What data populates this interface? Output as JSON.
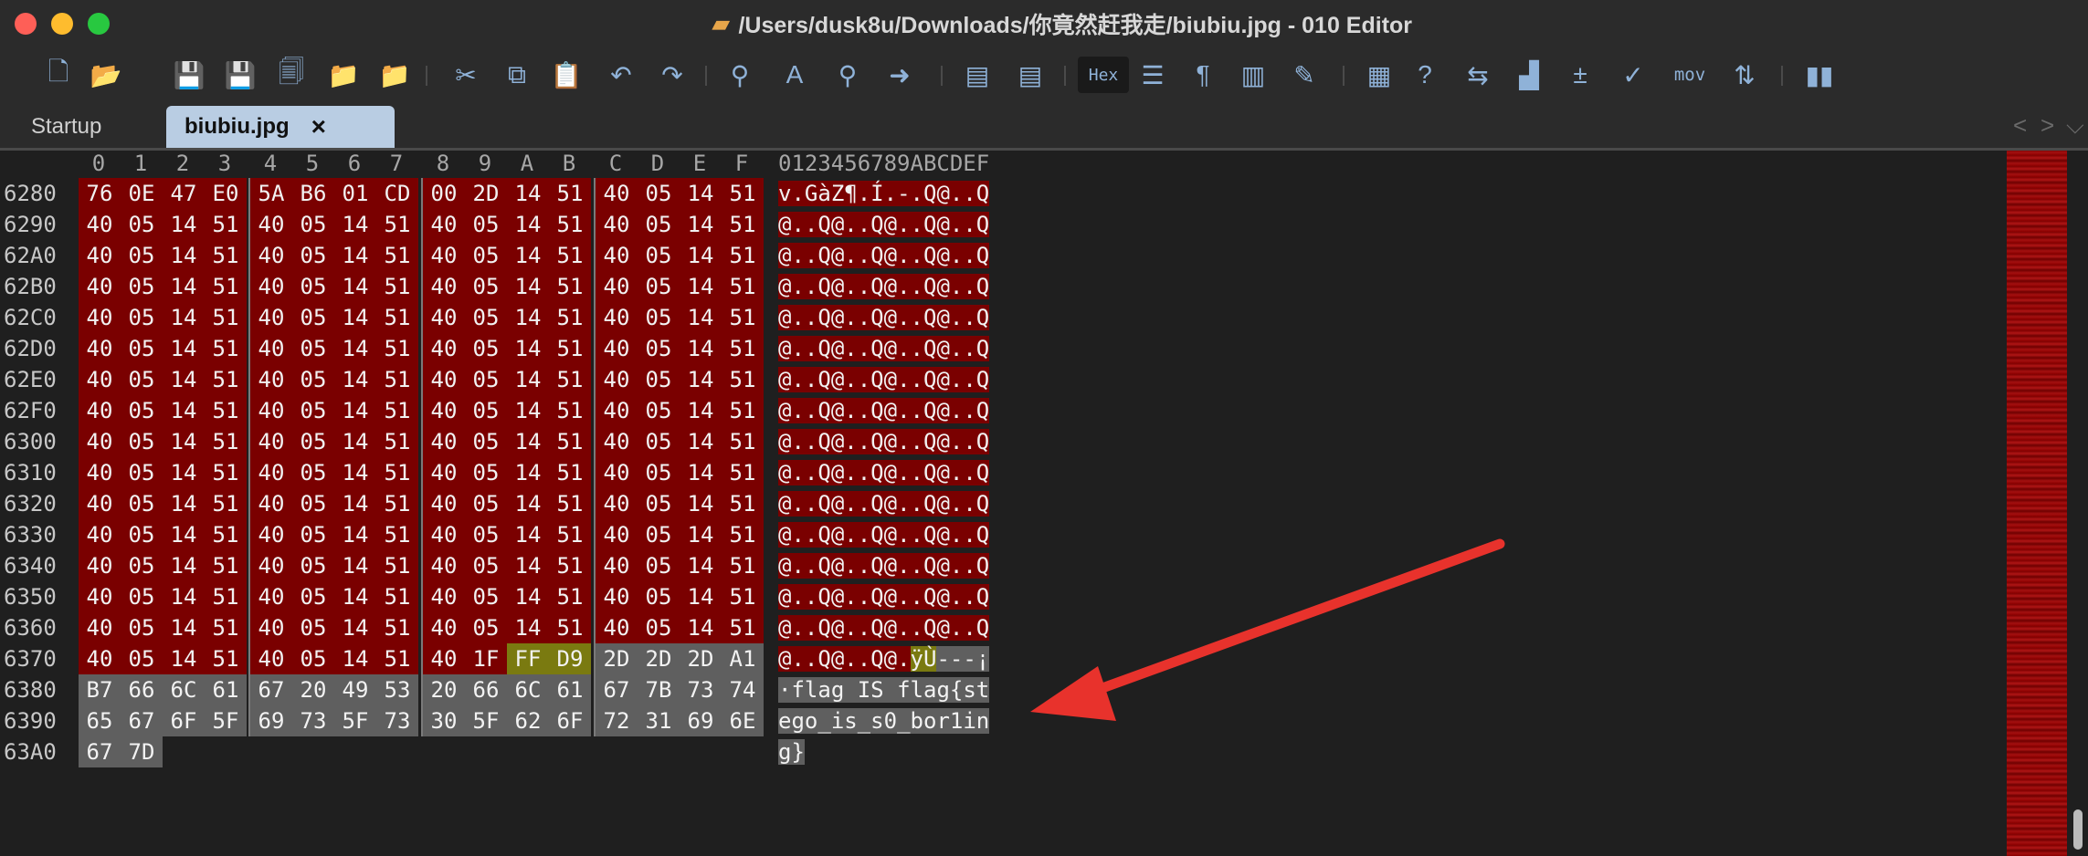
{
  "window": {
    "title": "/Users/dusk8u/Downloads/你竟然赶我走/biubiu.jpg - 010 Editor",
    "title_icon": "document-icon"
  },
  "toolbar": {
    "buttons": [
      {
        "name": "new-file-icon",
        "glyph": "🗋"
      },
      {
        "name": "open-file-icon",
        "glyph": "📂"
      },
      {
        "name": "save-icon",
        "glyph": "💾"
      },
      {
        "name": "save-as-icon",
        "glyph": "💾"
      },
      {
        "name": "save-all-icon",
        "glyph": "🗐"
      },
      {
        "name": "open-folder-icon",
        "glyph": "📁"
      },
      {
        "name": "open-workspace-icon",
        "glyph": "📁"
      },
      {
        "name": "cut-icon",
        "glyph": "✂"
      },
      {
        "name": "copy-icon",
        "glyph": "⧉"
      },
      {
        "name": "paste-icon",
        "glyph": "📋"
      },
      {
        "name": "undo-icon",
        "glyph": "↶"
      },
      {
        "name": "redo-icon",
        "glyph": "↷"
      },
      {
        "name": "find-icon",
        "glyph": "⚲"
      },
      {
        "name": "replace-icon",
        "glyph": "A"
      },
      {
        "name": "find-in-files-icon",
        "glyph": "⚲"
      },
      {
        "name": "goto-icon",
        "glyph": "➜"
      },
      {
        "name": "run-script-icon",
        "glyph": "▤"
      },
      {
        "name": "run-template-icon",
        "glyph": "▤"
      },
      {
        "name": "hex-mode-button",
        "glyph": "Hex"
      },
      {
        "name": "columns-icon",
        "glyph": "☰"
      },
      {
        "name": "show-whitespace-icon",
        "glyph": "¶"
      },
      {
        "name": "line-width-icon",
        "glyph": "▥"
      },
      {
        "name": "highlight-icon",
        "glyph": "✎"
      },
      {
        "name": "calculator-icon",
        "glyph": "▦"
      },
      {
        "name": "inspector-icon",
        "glyph": "?"
      },
      {
        "name": "compare-icon",
        "glyph": "⇆"
      },
      {
        "name": "histogram-icon",
        "glyph": "▟"
      },
      {
        "name": "checksum-icon",
        "glyph": "±"
      },
      {
        "name": "check-icon",
        "glyph": "✓"
      },
      {
        "name": "disassemble-button",
        "glyph": "mov"
      },
      {
        "name": "base-convert-icon",
        "glyph": "⇅"
      },
      {
        "name": "pause-icon",
        "glyph": "▮▮"
      }
    ]
  },
  "tabs": [
    {
      "label": "Startup",
      "active": false
    },
    {
      "label": "biubiu.jpg",
      "active": true,
      "close": "×"
    }
  ],
  "tab_nav": {
    "prev": "<",
    "next": ">",
    "menu": "⌵"
  },
  "hex_editor": {
    "column_headers": [
      "0",
      "1",
      "2",
      "3",
      "4",
      "5",
      "6",
      "7",
      "8",
      "9",
      "A",
      "B",
      "C",
      "D",
      "E",
      "F"
    ],
    "ascii_header": "0123456789ABCDEF",
    "rows": [
      {
        "addr": "6280",
        "bytes": [
          "76",
          "0E",
          "47",
          "E0",
          "5A",
          "B6",
          "01",
          "CD",
          "00",
          "2D",
          "14",
          "51",
          "40",
          "05",
          "14",
          "51"
        ],
        "ascii": "v.GàZ¶.Í.-.Q@..Q",
        "hl": [
          "r",
          "r",
          "r",
          "r",
          "r",
          "r",
          "r",
          "r",
          "r",
          "r",
          "r",
          "r",
          "r",
          "r",
          "r",
          "r"
        ]
      },
      {
        "addr": "6290",
        "bytes": [
          "40",
          "05",
          "14",
          "51",
          "40",
          "05",
          "14",
          "51",
          "40",
          "05",
          "14",
          "51",
          "40",
          "05",
          "14",
          "51"
        ],
        "ascii": "@..Q@..Q@..Q@..Q",
        "hl": [
          "r",
          "r",
          "r",
          "r",
          "r",
          "r",
          "r",
          "r",
          "r",
          "r",
          "r",
          "r",
          "r",
          "r",
          "r",
          "r"
        ]
      },
      {
        "addr": "62A0",
        "bytes": [
          "40",
          "05",
          "14",
          "51",
          "40",
          "05",
          "14",
          "51",
          "40",
          "05",
          "14",
          "51",
          "40",
          "05",
          "14",
          "51"
        ],
        "ascii": "@..Q@..Q@..Q@..Q",
        "hl": [
          "r",
          "r",
          "r",
          "r",
          "r",
          "r",
          "r",
          "r",
          "r",
          "r",
          "r",
          "r",
          "r",
          "r",
          "r",
          "r"
        ]
      },
      {
        "addr": "62B0",
        "bytes": [
          "40",
          "05",
          "14",
          "51",
          "40",
          "05",
          "14",
          "51",
          "40",
          "05",
          "14",
          "51",
          "40",
          "05",
          "14",
          "51"
        ],
        "ascii": "@..Q@..Q@..Q@..Q",
        "hl": [
          "r",
          "r",
          "r",
          "r",
          "r",
          "r",
          "r",
          "r",
          "r",
          "r",
          "r",
          "r",
          "r",
          "r",
          "r",
          "r"
        ]
      },
      {
        "addr": "62C0",
        "bytes": [
          "40",
          "05",
          "14",
          "51",
          "40",
          "05",
          "14",
          "51",
          "40",
          "05",
          "14",
          "51",
          "40",
          "05",
          "14",
          "51"
        ],
        "ascii": "@..Q@..Q@..Q@..Q",
        "hl": [
          "r",
          "r",
          "r",
          "r",
          "r",
          "r",
          "r",
          "r",
          "r",
          "r",
          "r",
          "r",
          "r",
          "r",
          "r",
          "r"
        ]
      },
      {
        "addr": "62D0",
        "bytes": [
          "40",
          "05",
          "14",
          "51",
          "40",
          "05",
          "14",
          "51",
          "40",
          "05",
          "14",
          "51",
          "40",
          "05",
          "14",
          "51"
        ],
        "ascii": "@..Q@..Q@..Q@..Q",
        "hl": [
          "r",
          "r",
          "r",
          "r",
          "r",
          "r",
          "r",
          "r",
          "r",
          "r",
          "r",
          "r",
          "r",
          "r",
          "r",
          "r"
        ]
      },
      {
        "addr": "62E0",
        "bytes": [
          "40",
          "05",
          "14",
          "51",
          "40",
          "05",
          "14",
          "51",
          "40",
          "05",
          "14",
          "51",
          "40",
          "05",
          "14",
          "51"
        ],
        "ascii": "@..Q@..Q@..Q@..Q",
        "hl": [
          "r",
          "r",
          "r",
          "r",
          "r",
          "r",
          "r",
          "r",
          "r",
          "r",
          "r",
          "r",
          "r",
          "r",
          "r",
          "r"
        ]
      },
      {
        "addr": "62F0",
        "bytes": [
          "40",
          "05",
          "14",
          "51",
          "40",
          "05",
          "14",
          "51",
          "40",
          "05",
          "14",
          "51",
          "40",
          "05",
          "14",
          "51"
        ],
        "ascii": "@..Q@..Q@..Q@..Q",
        "hl": [
          "r",
          "r",
          "r",
          "r",
          "r",
          "r",
          "r",
          "r",
          "r",
          "r",
          "r",
          "r",
          "r",
          "r",
          "r",
          "r"
        ]
      },
      {
        "addr": "6300",
        "bytes": [
          "40",
          "05",
          "14",
          "51",
          "40",
          "05",
          "14",
          "51",
          "40",
          "05",
          "14",
          "51",
          "40",
          "05",
          "14",
          "51"
        ],
        "ascii": "@..Q@..Q@..Q@..Q",
        "hl": [
          "r",
          "r",
          "r",
          "r",
          "r",
          "r",
          "r",
          "r",
          "r",
          "r",
          "r",
          "r",
          "r",
          "r",
          "r",
          "r"
        ]
      },
      {
        "addr": "6310",
        "bytes": [
          "40",
          "05",
          "14",
          "51",
          "40",
          "05",
          "14",
          "51",
          "40",
          "05",
          "14",
          "51",
          "40",
          "05",
          "14",
          "51"
        ],
        "ascii": "@..Q@..Q@..Q@..Q",
        "hl": [
          "r",
          "r",
          "r",
          "r",
          "r",
          "r",
          "r",
          "r",
          "r",
          "r",
          "r",
          "r",
          "r",
          "r",
          "r",
          "r"
        ]
      },
      {
        "addr": "6320",
        "bytes": [
          "40",
          "05",
          "14",
          "51",
          "40",
          "05",
          "14",
          "51",
          "40",
          "05",
          "14",
          "51",
          "40",
          "05",
          "14",
          "51"
        ],
        "ascii": "@..Q@..Q@..Q@..Q",
        "hl": [
          "r",
          "r",
          "r",
          "r",
          "r",
          "r",
          "r",
          "r",
          "r",
          "r",
          "r",
          "r",
          "r",
          "r",
          "r",
          "r"
        ]
      },
      {
        "addr": "6330",
        "bytes": [
          "40",
          "05",
          "14",
          "51",
          "40",
          "05",
          "14",
          "51",
          "40",
          "05",
          "14",
          "51",
          "40",
          "05",
          "14",
          "51"
        ],
        "ascii": "@..Q@..Q@..Q@..Q",
        "hl": [
          "r",
          "r",
          "r",
          "r",
          "r",
          "r",
          "r",
          "r",
          "r",
          "r",
          "r",
          "r",
          "r",
          "r",
          "r",
          "r"
        ]
      },
      {
        "addr": "6340",
        "bytes": [
          "40",
          "05",
          "14",
          "51",
          "40",
          "05",
          "14",
          "51",
          "40",
          "05",
          "14",
          "51",
          "40",
          "05",
          "14",
          "51"
        ],
        "ascii": "@..Q@..Q@..Q@..Q",
        "hl": [
          "r",
          "r",
          "r",
          "r",
          "r",
          "r",
          "r",
          "r",
          "r",
          "r",
          "r",
          "r",
          "r",
          "r",
          "r",
          "r"
        ]
      },
      {
        "addr": "6350",
        "bytes": [
          "40",
          "05",
          "14",
          "51",
          "40",
          "05",
          "14",
          "51",
          "40",
          "05",
          "14",
          "51",
          "40",
          "05",
          "14",
          "51"
        ],
        "ascii": "@..Q@..Q@..Q@..Q",
        "hl": [
          "r",
          "r",
          "r",
          "r",
          "r",
          "r",
          "r",
          "r",
          "r",
          "r",
          "r",
          "r",
          "r",
          "r",
          "r",
          "r"
        ]
      },
      {
        "addr": "6360",
        "bytes": [
          "40",
          "05",
          "14",
          "51",
          "40",
          "05",
          "14",
          "51",
          "40",
          "05",
          "14",
          "51",
          "40",
          "05",
          "14",
          "51"
        ],
        "ascii": "@..Q@..Q@..Q@..Q",
        "hl": [
          "r",
          "r",
          "r",
          "r",
          "r",
          "r",
          "r",
          "r",
          "r",
          "r",
          "r",
          "r",
          "r",
          "r",
          "r",
          "r"
        ]
      },
      {
        "addr": "6370",
        "bytes": [
          "40",
          "05",
          "14",
          "51",
          "40",
          "05",
          "14",
          "51",
          "40",
          "1F",
          "FF",
          "D9",
          "2D",
          "2D",
          "2D",
          "A1"
        ],
        "ascii": "@..Q@..Q@.ÿÙ---¡",
        "hl": [
          "r",
          "r",
          "r",
          "r",
          "r",
          "r",
          "r",
          "r",
          "r",
          "r",
          "y",
          "y",
          "g",
          "g",
          "g",
          "g"
        ]
      },
      {
        "addr": "6380",
        "bytes": [
          "B7",
          "66",
          "6C",
          "61",
          "67",
          "20",
          "49",
          "53",
          "20",
          "66",
          "6C",
          "61",
          "67",
          "7B",
          "73",
          "74"
        ],
        "ascii": "·flag IS flag{st",
        "hl": [
          "g",
          "g",
          "g",
          "g",
          "g",
          "g",
          "g",
          "g",
          "g",
          "g",
          "g",
          "g",
          "g",
          "g",
          "g",
          "g"
        ]
      },
      {
        "addr": "6390",
        "bytes": [
          "65",
          "67",
          "6F",
          "5F",
          "69",
          "73",
          "5F",
          "73",
          "30",
          "5F",
          "62",
          "6F",
          "72",
          "31",
          "69",
          "6E"
        ],
        "ascii": "ego_is_s0_bor1in",
        "hl": [
          "g",
          "g",
          "g",
          "g",
          "g",
          "g",
          "g",
          "g",
          "g",
          "g",
          "g",
          "g",
          "g",
          "g",
          "g",
          "g"
        ]
      },
      {
        "addr": "63A0",
        "bytes": [
          "67",
          "7D"
        ],
        "ascii": "g}",
        "hl": [
          "g",
          "g"
        ]
      }
    ]
  },
  "colors": {
    "red_highlight": "#7a0000",
    "yellow_highlight": "#7a7a10",
    "gray_highlight": "#5f5f5f",
    "annotation_arrow": "#e8322c"
  }
}
